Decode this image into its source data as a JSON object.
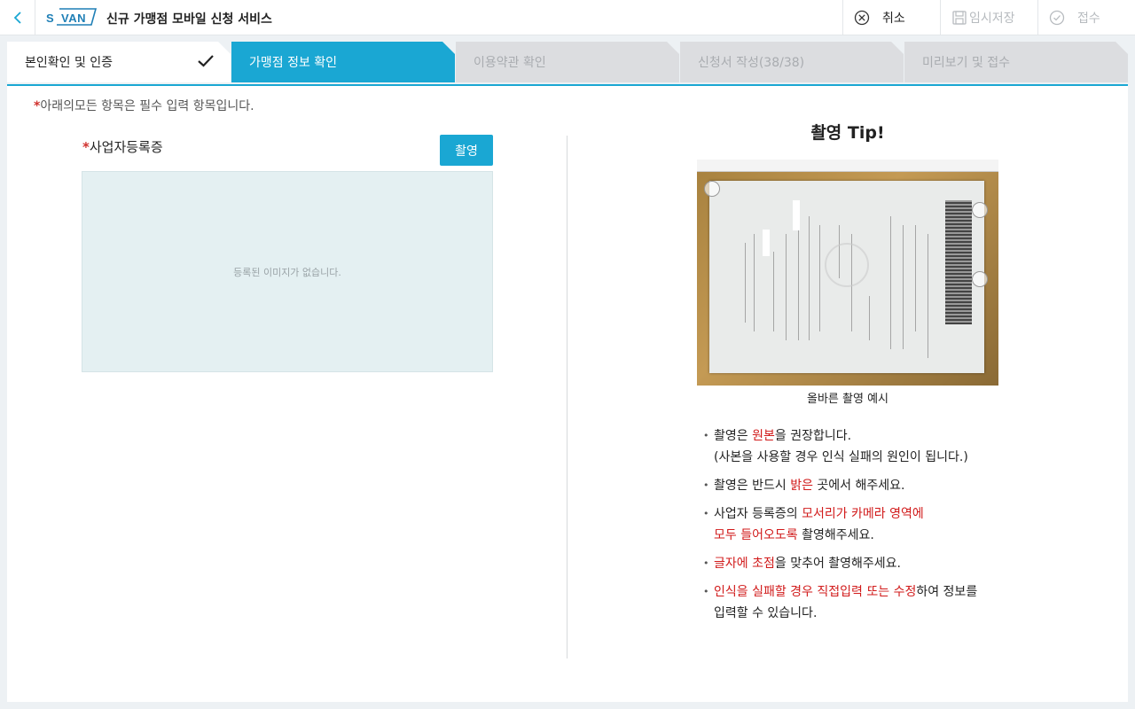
{
  "header": {
    "logo_s": "S",
    "logo_van": "VAN",
    "title": "신규 가맹점 모바일 신청 서비스",
    "cancel_label": "취소",
    "save_label": "임시저장",
    "submit_label": "접수"
  },
  "steps": [
    {
      "label": "본인확인 및 인증",
      "state": "done"
    },
    {
      "label": "가맹점 정보 확인",
      "state": "active"
    },
    {
      "label": "이용약관 확인",
      "state": "pending"
    },
    {
      "label": "신청서 작성(38/38)",
      "state": "pending"
    },
    {
      "label": "미리보기 및 접수",
      "state": "pending"
    }
  ],
  "form": {
    "required_star": "*",
    "required_note": "아래의모든 항목은 필수 입력 항목입니다.",
    "doc_label": "사업자등록증",
    "shoot_label": "촬영",
    "empty_image": "등록된 이미지가 없습니다."
  },
  "tips": {
    "title": "촬영 Tip!",
    "caption": "올바른 촬영 예시",
    "items": [
      {
        "pre": "촬영은 ",
        "hl": "원본",
        "post": "을 권장합니다.",
        "line2": "(사본을 사용할 경우 인식 실패의 원인이 됩니다.)"
      },
      {
        "pre": "촬영은 반드시 ",
        "hl": "밝은",
        "post": " 곳에서 해주세요."
      },
      {
        "pre": "사업자 등록증의 ",
        "hl": "모서리가 카메라 영역에",
        "hl2": "모두 들어오도록",
        "post": " 촬영해주세요."
      },
      {
        "pre": "",
        "hl": "글자에 초점",
        "post": "을 맞추어 촬영해주세요."
      },
      {
        "pre": "",
        "hl": "인식을 실패할 경우 직접입력 또는 수정",
        "post": "하여 정보를",
        "line2": "입력할 수 있습니다."
      }
    ]
  },
  "colors": {
    "accent": "#1aa7d3",
    "highlight": "#d11a1a",
    "pending_tab": "#dcdde0"
  }
}
